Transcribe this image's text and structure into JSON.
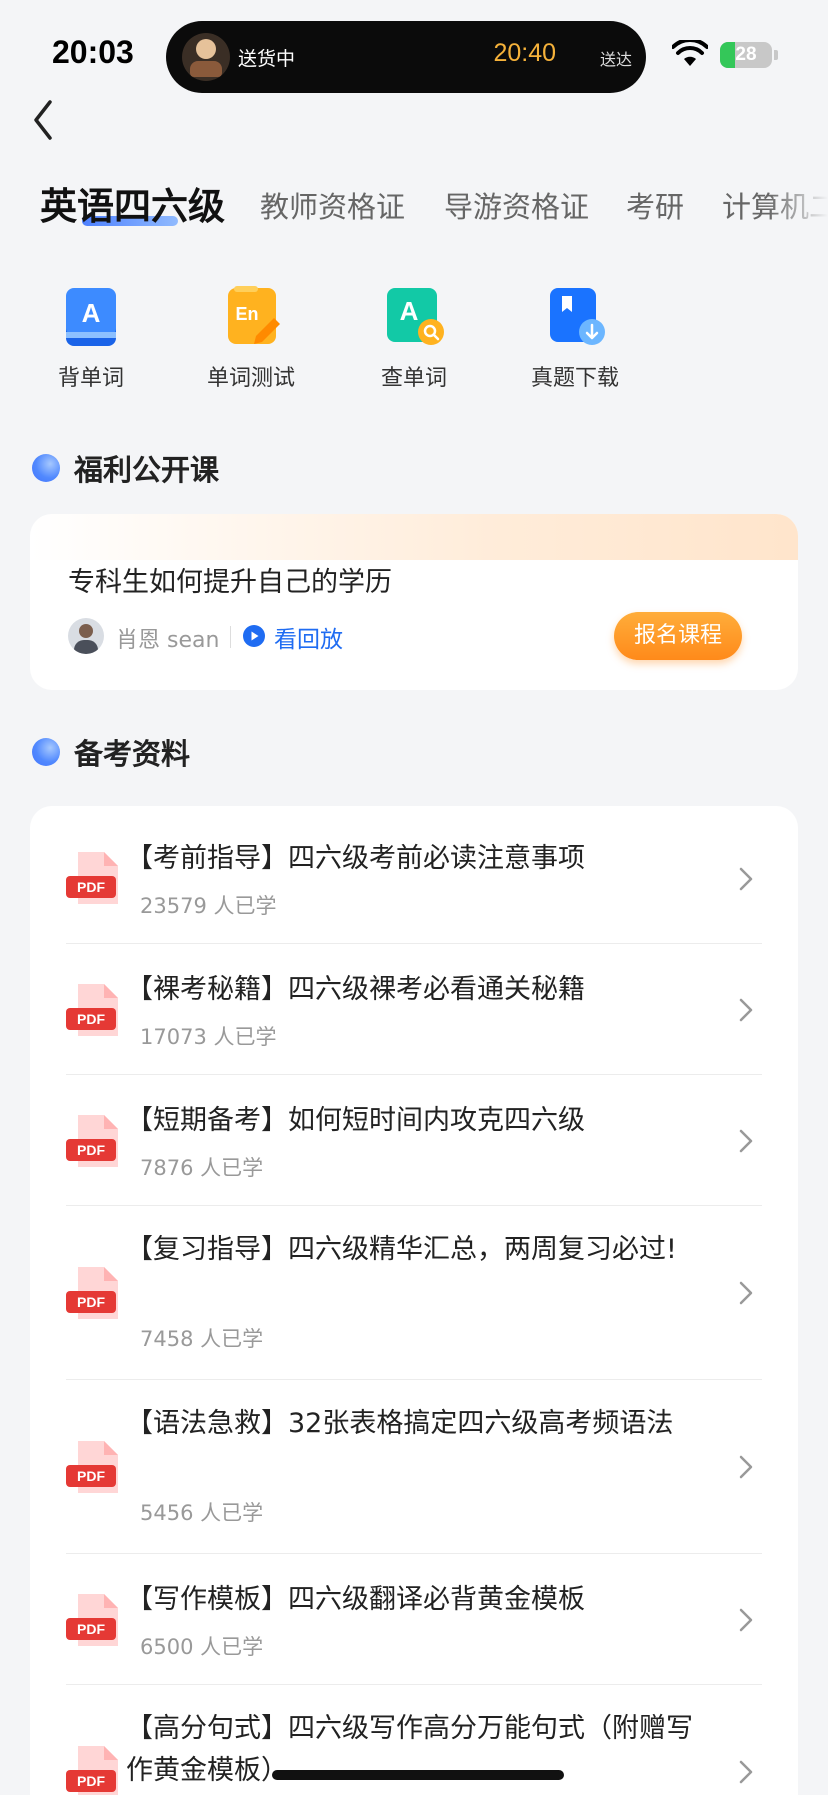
{
  "status_bar": {
    "time": "20:03",
    "activity": {
      "status": "送货中",
      "eta": "20:40",
      "eta_label": "送达"
    },
    "battery_level": "28",
    "battery_fraction": 0.28
  },
  "tabs": [
    {
      "label": "英语四六级",
      "active": true
    },
    {
      "label": "教师资格证",
      "active": false
    },
    {
      "label": "导游资格证",
      "active": false
    },
    {
      "label": "考研",
      "active": false
    },
    {
      "label": "计算机二",
      "active": false
    }
  ],
  "tools": [
    {
      "label": "背单词",
      "icon": "vocabulary-book-icon"
    },
    {
      "label": "单词测试",
      "icon": "word-test-icon"
    },
    {
      "label": "查单词",
      "icon": "word-search-icon"
    },
    {
      "label": "真题下载",
      "icon": "exam-download-icon"
    }
  ],
  "free_class": {
    "section_title": "福利公开课",
    "title": "专科生如何提升自己的学历",
    "teacher": "肖恩 sean",
    "replay_label": "看回放",
    "enroll_label": "报名课程"
  },
  "materials": {
    "section_title": "备考资料",
    "items": [
      {
        "title": "【考前指导】四六级考前必读注意事项",
        "count": "23579 人已学"
      },
      {
        "title": "【裸考秘籍】四六级裸考必看通关秘籍",
        "count": "17073 人已学"
      },
      {
        "title": "【短期备考】如何短时间内攻克四六级",
        "count": "7876 人已学"
      },
      {
        "title": "【复习指导】四六级精华汇总，两周复习必过!",
        "count": "7458 人已学"
      },
      {
        "title": "【语法急救】32张表格搞定四六级高考频语法",
        "count": "5456 人已学"
      },
      {
        "title": "【写作模板】四六级翻译必背黄金模板",
        "count": "6500 人已学"
      },
      {
        "title": "【高分句式】四六级写作高分万能句式（附赠写作黄金模板）",
        "count": ""
      }
    ]
  },
  "colors": {
    "accent_blue": "#1f6cf2",
    "enroll_orange": "#ff8a1a",
    "pdf_red": "#e53935",
    "background": "#f4f5f7"
  }
}
